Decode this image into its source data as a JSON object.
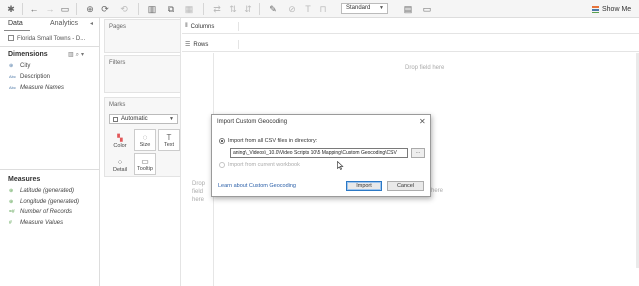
{
  "toolbar": {
    "icons": [
      "tableau-logo-icon",
      "undo-icon",
      "redo-icon",
      "save-icon",
      "new-datasource-icon",
      "pause-updates-icon",
      "run-update-icon",
      "new-worksheet-icon",
      "duplicate-icon",
      "clear-sheet-icon",
      "swap-icon",
      "sort-ascending-icon",
      "sort-descending-icon",
      "highlight-icon",
      "group-icon",
      "labels-icon",
      "fix-axes-icon",
      "fit-icon",
      "presentation-icon"
    ],
    "fit_value": "Standard",
    "show_me_label": "Show Me"
  },
  "data_pane": {
    "tabs": [
      "Data",
      "Analytics"
    ],
    "datasource": "Florida Small Towns - D...",
    "dimensions_title": "Dimensions",
    "dimensions": [
      {
        "name": "City",
        "type": "geo"
      },
      {
        "name": "Description",
        "type": "string"
      },
      {
        "name": "Measure Names",
        "type": "string",
        "italic": true
      }
    ],
    "measures_title": "Measures",
    "measures": [
      {
        "name": "Latitude (generated)",
        "type": "geo",
        "italic": true
      },
      {
        "name": "Longitude (generated)",
        "type": "geo",
        "italic": true
      },
      {
        "name": "Number of Records",
        "type": "number",
        "italic": true
      },
      {
        "name": "Measure Values",
        "type": "number",
        "italic": true
      }
    ]
  },
  "cards": {
    "pages": "Pages",
    "filters": "Filters",
    "marks": "Marks",
    "mark_type": "Automatic",
    "mark_buttons": [
      "Color",
      "Size",
      "Text",
      "Detail",
      "Tooltip"
    ]
  },
  "shelves": {
    "columns": "Columns",
    "rows": "Rows"
  },
  "canvas": {
    "drop_field_top": "Drop field here",
    "drop_field_left": [
      "Drop",
      "field",
      "here"
    ],
    "drop_field_right": "here"
  },
  "dialog": {
    "title": "Import Custom Geocoding",
    "option_csv": "Import from all CSV files in directory:",
    "path_value": "aning\\_Videos\\_10.0\\Video Scripts 10\\5 Mapping\\Custom Geocoding\\CSV",
    "browse_label": "...",
    "option_workbook": "Import from current workbook",
    "learn_link": "Learn about Custom Geocoding",
    "import_button": "Import",
    "cancel_button": "Cancel"
  }
}
